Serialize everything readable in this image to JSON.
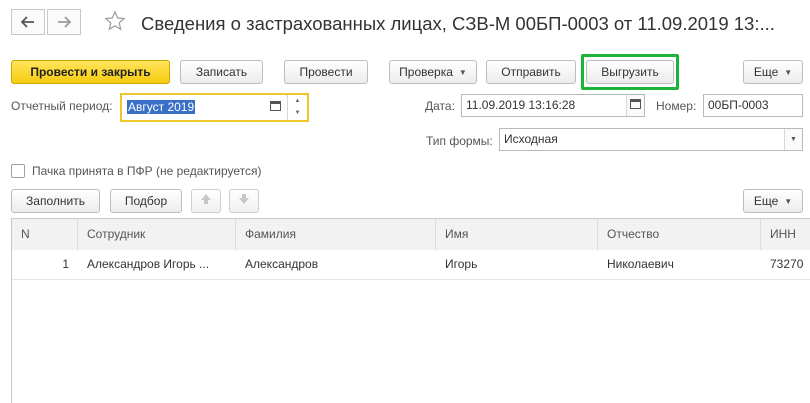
{
  "window": {
    "title": "Сведения о застрахованных лицах, СЗВ-М 00БП-0003 от 11.09.2019 13:..."
  },
  "toolbar": {
    "post_and_close": "Провести и закрыть",
    "save": "Записать",
    "post": "Провести",
    "check": "Проверка",
    "send": "Отправить",
    "export": "Выгрузить",
    "more": "Еще"
  },
  "form": {
    "period_label": "Отчетный период:",
    "period_value": "Август 2019",
    "date_label": "Дата:",
    "date_value": "11.09.2019 13:16:28",
    "number_label": "Номер:",
    "number_value": "00БП-0003",
    "form_type_label": "Тип формы:",
    "form_type_value": "Исходная",
    "accepted_label": "Пачка принята в ПФР (не редактируется)"
  },
  "table_toolbar": {
    "fill": "Заполнить",
    "pick": "Подбор",
    "more": "Еще"
  },
  "table": {
    "columns": [
      "N",
      "Сотрудник",
      "Фамилия",
      "Имя",
      "Отчество",
      "ИНН"
    ],
    "rows": [
      {
        "n": "1",
        "employee": "Александров Игорь ...",
        "last_name": "Александров",
        "first_name": "Игорь",
        "patronymic": "Николаевич",
        "inn": "73270"
      }
    ]
  },
  "colors": {
    "primary_button": "#f6cb10",
    "highlight_frame": "#1db23a",
    "active_field_border": "#f0c72a",
    "selection": "#3a6fc8"
  },
  "icons": [
    "back-arrow-icon",
    "forward-arrow-icon",
    "star-icon",
    "calendar-icon",
    "spin-up-icon",
    "spin-down-icon",
    "chevron-down-icon",
    "arrow-up-icon",
    "arrow-down-icon"
  ]
}
